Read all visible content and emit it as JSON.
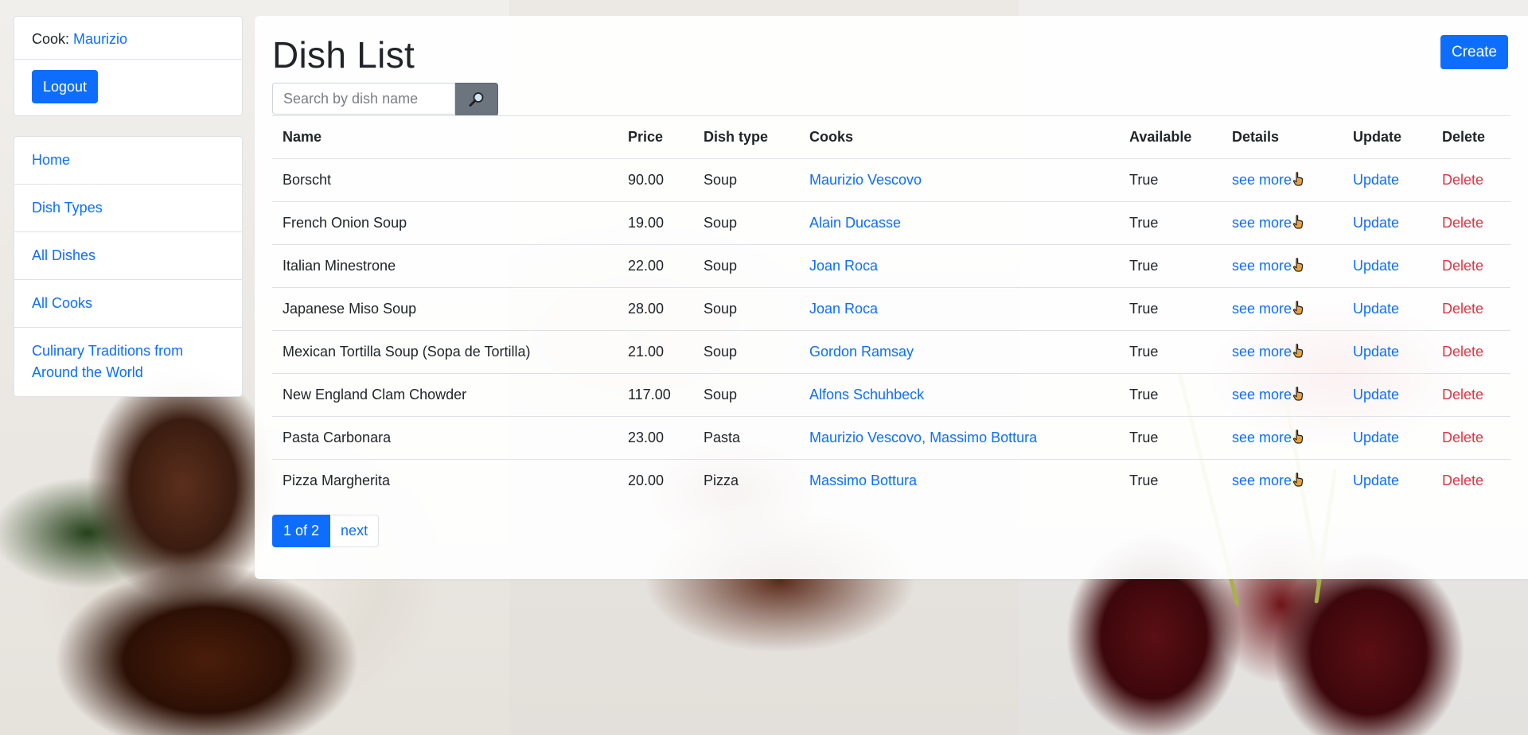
{
  "sidebar": {
    "cook_label": "Cook:",
    "cook_name": "Maurizio",
    "logout_label": "Logout",
    "nav": [
      {
        "label": "Home"
      },
      {
        "label": "Dish Types"
      },
      {
        "label": "All Dishes"
      },
      {
        "label": "All Cooks"
      },
      {
        "label": "Culinary Traditions from Around the World"
      }
    ]
  },
  "main": {
    "title": "Dish List",
    "create_label": "Create",
    "search_placeholder": "Search by dish name",
    "columns": [
      "Name",
      "Price",
      "Dish type",
      "Cooks",
      "Available",
      "Details",
      "Update",
      "Delete"
    ],
    "rows": [
      {
        "name": "Borscht",
        "price": "90.00",
        "dish_type": "Soup",
        "cooks": "Maurizio Vescovo",
        "available": "True",
        "details": "see more",
        "update": "Update",
        "delete": "Delete"
      },
      {
        "name": "French Onion Soup",
        "price": "19.00",
        "dish_type": "Soup",
        "cooks": "Alain Ducasse",
        "available": "True",
        "details": "see more",
        "update": "Update",
        "delete": "Delete"
      },
      {
        "name": "Italian Minestrone",
        "price": "22.00",
        "dish_type": "Soup",
        "cooks": "Joan Roca",
        "available": "True",
        "details": "see more",
        "update": "Update",
        "delete": "Delete"
      },
      {
        "name": "Japanese Miso Soup",
        "price": "28.00",
        "dish_type": "Soup",
        "cooks": "Joan Roca",
        "available": "True",
        "details": "see more",
        "update": "Update",
        "delete": "Delete"
      },
      {
        "name": "Mexican Tortilla Soup (Sopa de Tortilla)",
        "price": "21.00",
        "dish_type": "Soup",
        "cooks": "Gordon Ramsay",
        "available": "True",
        "details": "see more",
        "update": "Update",
        "delete": "Delete"
      },
      {
        "name": "New England Clam Chowder",
        "price": "117.00",
        "dish_type": "Soup",
        "cooks": "Alfons Schuhbeck",
        "available": "True",
        "details": "see more",
        "update": "Update",
        "delete": "Delete"
      },
      {
        "name": "Pasta Carbonara",
        "price": "23.00",
        "dish_type": "Pasta",
        "cooks": "Maurizio Vescovo, Massimo Bottura",
        "available": "True",
        "details": "see more",
        "update": "Update",
        "delete": "Delete"
      },
      {
        "name": "Pizza Margherita",
        "price": "20.00",
        "dish_type": "Pizza",
        "cooks": "Massimo Bottura",
        "available": "True",
        "details": "see more",
        "update": "Update",
        "delete": "Delete"
      }
    ],
    "pagination": {
      "current": "1 of 2",
      "next": "next"
    }
  },
  "colors": {
    "primary": "#0d6efd",
    "danger": "#dc3545",
    "secondary": "#6c757d"
  },
  "icons": {
    "search": "magnifier-icon",
    "details": "pointing-hand-icon"
  }
}
